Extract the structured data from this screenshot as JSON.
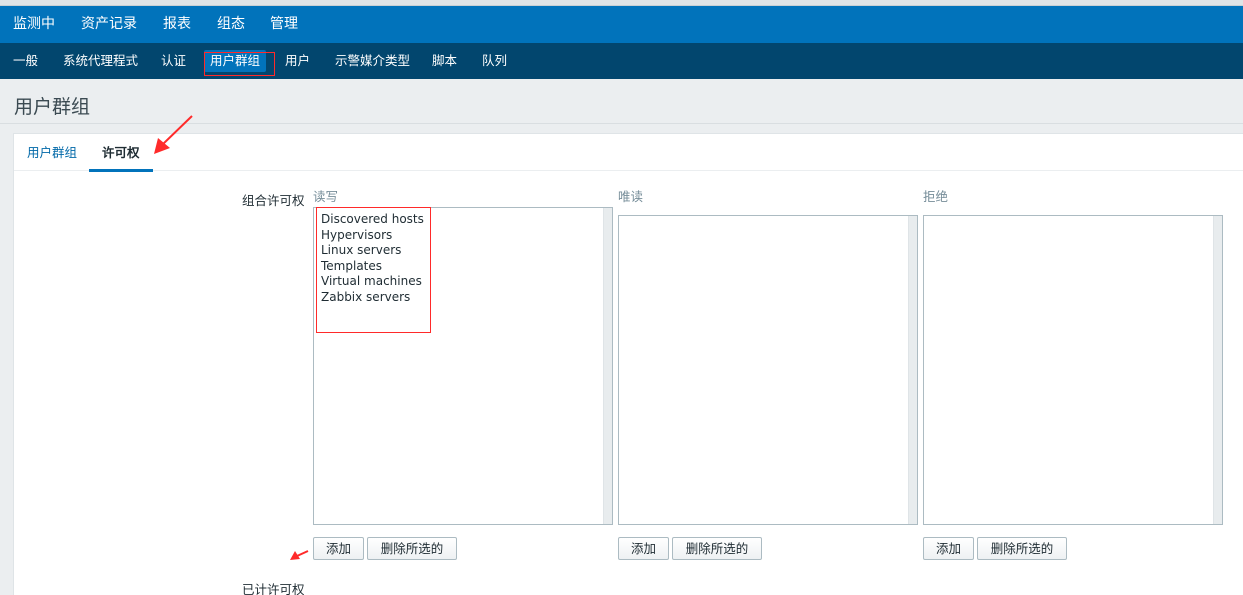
{
  "main_nav": {
    "items": [
      "监测中",
      "资产记录",
      "报表",
      "组态",
      "管理"
    ],
    "active": "管理"
  },
  "sub_nav": {
    "items": [
      "一般",
      "系统代理程式",
      "认证",
      "用户群组",
      "用户",
      "示警媒介类型",
      "脚本",
      "队列"
    ],
    "active": "用户群组"
  },
  "page": {
    "title": "用户群组"
  },
  "tabs": {
    "items": [
      "用户群组",
      "许可权"
    ],
    "active": "许可权"
  },
  "form": {
    "group_permissions_label": "组合许可权",
    "calculated_permissions_label": "已计许可权",
    "columns": [
      {
        "heading": "读写",
        "options": [
          "Discovered hosts",
          "Hypervisors",
          "Linux servers",
          "Templates",
          "Virtual machines",
          "Zabbix servers"
        ],
        "add_label": "添加",
        "remove_label": "删除所选的"
      },
      {
        "heading": "唯读",
        "options": [],
        "add_label": "添加",
        "remove_label": "删除所选的"
      },
      {
        "heading": "拒绝",
        "options": [],
        "add_label": "添加",
        "remove_label": "删除所选的"
      }
    ]
  },
  "colors": {
    "main_nav_bg": "#0173bb",
    "sub_nav_bg": "#02466e",
    "link": "#0068a8",
    "annotation_red": "#ff2a2a"
  }
}
